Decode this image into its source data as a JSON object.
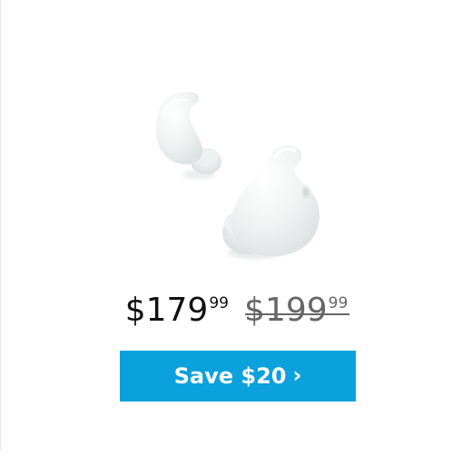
{
  "offer": {
    "current_price_dollars": "$179",
    "current_price_cents": "99",
    "original_price_dollars": "$199",
    "original_price_cents": "99",
    "cta_label": "Save $20",
    "cta_icon": "chevron-right-icon",
    "cta_chevron": "›",
    "cta_color": "#0aa1dd"
  },
  "product": {
    "image_icon": "earbuds-image"
  }
}
